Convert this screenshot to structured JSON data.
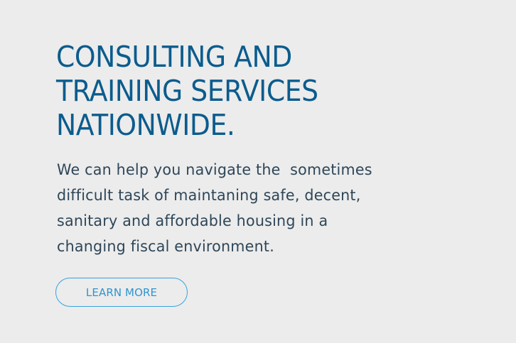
{
  "hero": {
    "headline_lines": [
      "CONSULTING AND",
      "TRAINING SERVICES",
      "NATIONWIDE."
    ],
    "body_lines": [
      "We can help you navigate the  sometimes",
      "difficult task of maintaning safe, decent,",
      "sanitary and affordable housing in a",
      "changing fiscal environment."
    ],
    "cta_label": "LEARN MORE"
  },
  "colors": {
    "background": "#ececec",
    "headline": "#0b5c8d",
    "body_text": "#2e4658",
    "button_border": "#36a3dc",
    "button_text": "#2e95cf"
  }
}
